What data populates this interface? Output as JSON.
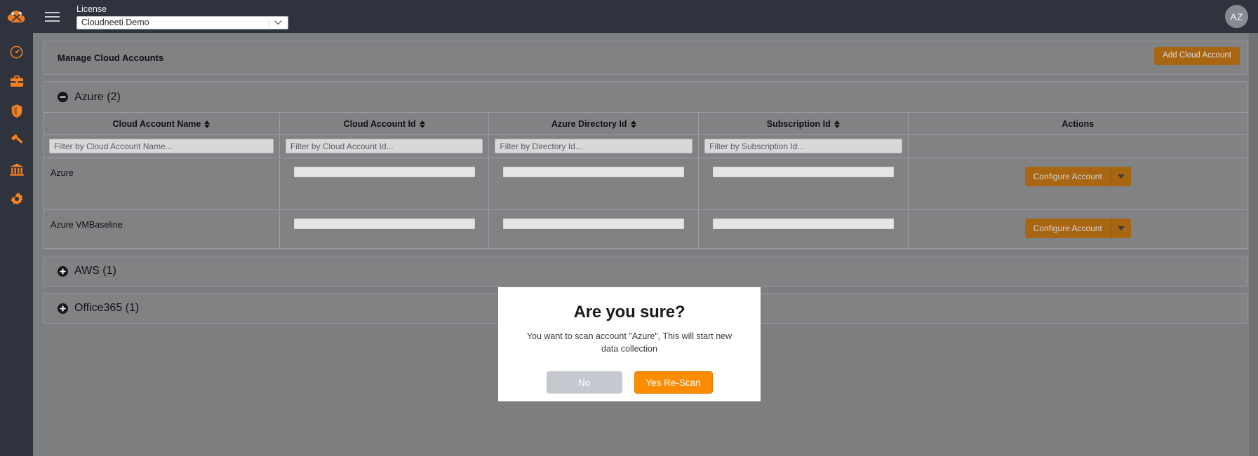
{
  "topbar": {
    "logo_icon": "cloudneeti-tools-logo-icon",
    "menu_icon": "hamburger-menu-icon",
    "license_label": "License",
    "license_value": "Cloudneeti Demo",
    "license_chevron_icon": "chevron-down-icon",
    "avatar_initials": "AZ"
  },
  "sidebar": {
    "items": [
      {
        "icon": "dashboard-speedometer-icon",
        "name": "sidebar-item-dashboard"
      },
      {
        "icon": "briefcase-icon",
        "name": "sidebar-item-business"
      },
      {
        "icon": "shield-icon",
        "name": "sidebar-item-security"
      },
      {
        "icon": "gavel-icon",
        "name": "sidebar-item-compliance"
      },
      {
        "icon": "bank-icon",
        "name": "sidebar-item-governance"
      },
      {
        "icon": "gear-icon",
        "name": "sidebar-item-settings"
      }
    ]
  },
  "page": {
    "title": "Manage Cloud Accounts",
    "add_button_label": "Add Cloud Account"
  },
  "groups": [
    {
      "name": "group-azure",
      "title": "Azure (2)",
      "expanded": true,
      "toggle_icon": "minus-circle-icon"
    },
    {
      "name": "group-aws",
      "title": "AWS (1)",
      "expanded": false,
      "toggle_icon": "plus-circle-icon"
    },
    {
      "name": "group-office365",
      "title": "Office365 (1)",
      "expanded": false,
      "toggle_icon": "plus-circle-icon"
    }
  ],
  "table": {
    "columns": [
      {
        "header": "Cloud Account Name",
        "sortable": true,
        "filter_placeholder": "Filter by Cloud Account Name..."
      },
      {
        "header": "Cloud Account Id",
        "sortable": true,
        "filter_placeholder": "Filter by Cloud Account Id..."
      },
      {
        "header": "Azure Directory Id",
        "sortable": true,
        "filter_placeholder": "Filter by Directory Id..."
      },
      {
        "header": "Subscription Id",
        "sortable": true,
        "filter_placeholder": "Filter by Subscription Id..."
      },
      {
        "header": "Actions",
        "sortable": false,
        "filter_placeholder": ""
      }
    ],
    "filter_values": [
      "",
      "",
      "",
      ""
    ],
    "rows": [
      {
        "account_name": "Azure",
        "cloud_account_id": "",
        "directory_id": "",
        "subscription_id": "",
        "action_label": "Configure Account",
        "action_caret_icon": "caret-down-icon"
      },
      {
        "account_name": "Azure VMBaseline",
        "cloud_account_id": "",
        "directory_id": "",
        "subscription_id": "",
        "action_label": "Configure Account",
        "action_caret_icon": "caret-down-icon"
      }
    ]
  },
  "modal": {
    "title": "Are you sure?",
    "message": "You want to scan account \"Azure\", This will start new data collection",
    "no_label": "No",
    "yes_label": "Yes Re-Scan"
  },
  "colors": {
    "chrome_dark": "#2e333d",
    "page_dim": "#7c7e80",
    "accent_orange": "#ff8c00",
    "accent_orange_dim": "#a86512",
    "panel": "#808284"
  }
}
